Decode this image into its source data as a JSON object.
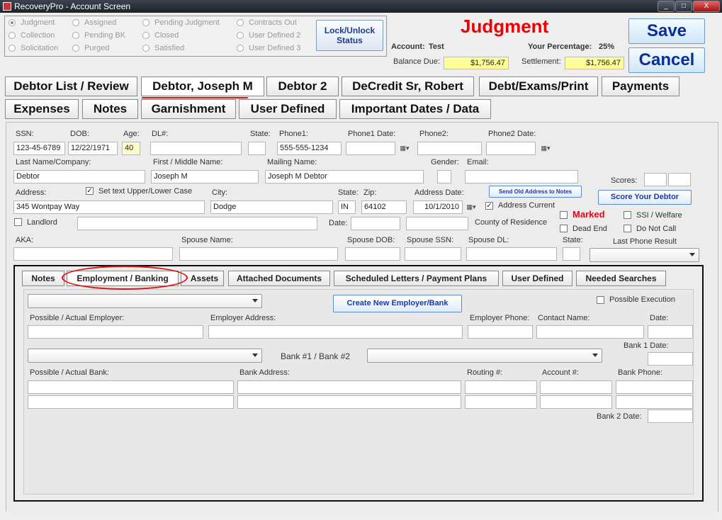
{
  "window": {
    "title": "RecoveryPro - Account Screen",
    "min": "_",
    "max": "□",
    "close": "X"
  },
  "status_radios": [
    {
      "label": "Judgment",
      "selected": true
    },
    {
      "label": "Collection",
      "selected": false
    },
    {
      "label": "Solicitation",
      "selected": false
    },
    {
      "label": "Assigned",
      "selected": false
    },
    {
      "label": "Pending BK",
      "selected": false
    },
    {
      "label": "Purged",
      "selected": false
    },
    {
      "label": "Pending Judgment",
      "selected": false
    },
    {
      "label": "Closed",
      "selected": false
    },
    {
      "label": "Satisfied",
      "selected": false
    },
    {
      "label": "Contracts Out",
      "selected": false
    },
    {
      "label": "User Defined 2",
      "selected": false
    },
    {
      "label": "User Defined 3",
      "selected": false
    }
  ],
  "lock_button": "Lock/Unlock Status",
  "status_heading": "Judgment",
  "account": {
    "label": "Account:",
    "value": "Test"
  },
  "percentage": {
    "label": "Your Percentage:",
    "value": "25%"
  },
  "balance": {
    "label": "Balance Due:",
    "value": "$1,756.47"
  },
  "settlement": {
    "label": "Settlement:",
    "value": "$1,756.47"
  },
  "save_label": "Save",
  "cancel_label": "Cancel",
  "main_tabs": [
    "Debtor List / Review",
    "Debtor, Joseph M",
    "Debtor 2",
    "DeCredit Sr, Robert",
    "Debt/Exams/Print",
    "Payments",
    "Expenses",
    "Notes",
    "Garnishment",
    "User Defined",
    "Important Dates / Data"
  ],
  "debtor": {
    "ssn_label": "SSN:",
    "ssn": "123-45-6789",
    "dob_label": "DOB:",
    "dob": "12/22/1971",
    "age_label": "Age:",
    "age": "40",
    "dl_label": "DL#:",
    "dl": "",
    "state_label": "State:",
    "state": "",
    "phone1_label": "Phone1:",
    "phone1": "555-555-1234",
    "phone1date_label": "Phone1 Date:",
    "phone1date": "",
    "phone2_label": "Phone2:",
    "phone2": "",
    "phone2date_label": "Phone2 Date:",
    "phone2date": "",
    "lastname_label": "Last Name/Company:",
    "lastname": "Debtor",
    "firstname_label": "First / Middle Name:",
    "firstname": "Joseph M",
    "mailing_label": "Mailing Name:",
    "mailing": "Joseph M Debtor",
    "gender_label": "Gender:",
    "gender": "",
    "email_label": "Email:",
    "email": "",
    "scores_label": "Scores:",
    "address_label": "Address:",
    "address": "345 Wontpay Way",
    "settext_label": "Set text Upper/Lower Case",
    "city_label": "City:",
    "city": "Dodge",
    "state2_label": "State:",
    "state2": "IN",
    "zip_label": "Zip:",
    "zip": "64102",
    "addrdate_label": "Address Date:",
    "addrdate": "10/1/2010",
    "sendold_label": "Send Old Address to Notes",
    "addrcurrent_label": "Address Current",
    "score_button": "Score Your Debtor",
    "marked_label": "Marked",
    "ssi_label": "SSI / Welfare",
    "landlord_label": "Landlord",
    "date_label": "Date:",
    "county_label": "County of Residence",
    "deadend_label": "Dead End",
    "donotcall_label": "Do Not Call",
    "aka_label": "AKA:",
    "spouse_label": "Spouse Name:",
    "spousedob_label": "Spouse DOB:",
    "spousessn_label": "Spouse SSN:",
    "spousedl_label": "Spouse DL:",
    "state3_label": "State:",
    "lastphone_label": "Last Phone Result"
  },
  "sub_tabs": [
    "Notes",
    "Employment / Banking",
    "Assets",
    "Attached Documents",
    "Scheduled Letters  /  Payment Plans",
    "User Defined",
    "Needed Searches"
  ],
  "employment": {
    "create_button": "Create New Employer/Bank",
    "possible_execution": "Possible Execution",
    "employer_label": "Possible / Actual Employer:",
    "employer_addr_label": "Employer Address:",
    "employer_phone_label": "Employer Phone:",
    "contact_label": "Contact Name:",
    "date_label": "Date:",
    "bank1date_label": "Bank 1 Date:",
    "bank_selector_label": "Bank #1  /  Bank #2",
    "bank_label": "Possible / Actual Bank:",
    "bank_addr_label": "Bank Address:",
    "routing_label": "Routing #:",
    "account_label": "Account #:",
    "bank_phone_label": "Bank Phone:",
    "bank2date_label": "Bank 2 Date:"
  }
}
